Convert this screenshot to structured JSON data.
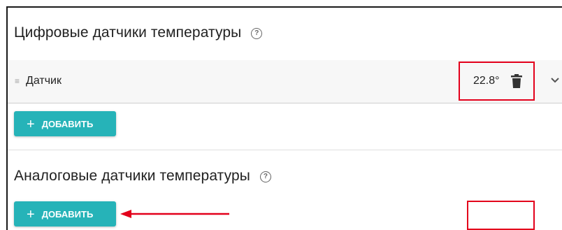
{
  "digital": {
    "title": "Цифровые датчики температуры",
    "help_icon": "?",
    "sensor": {
      "name": "Датчик",
      "value": "22.8°",
      "handle": "≡"
    },
    "add_button": {
      "plus": "+",
      "label": "ДОБАВИТЬ"
    }
  },
  "analog": {
    "title": "Аналоговые датчики температуры",
    "help_icon": "?",
    "add_button": {
      "plus": "+",
      "label": "ДОБАВИТЬ"
    }
  },
  "colors": {
    "accent": "#26b3b8",
    "highlight": "#e3001b"
  },
  "icons": [
    "help-icon",
    "drag-handle-icon",
    "trash-icon",
    "chevron-down-icon",
    "plus-icon"
  ]
}
